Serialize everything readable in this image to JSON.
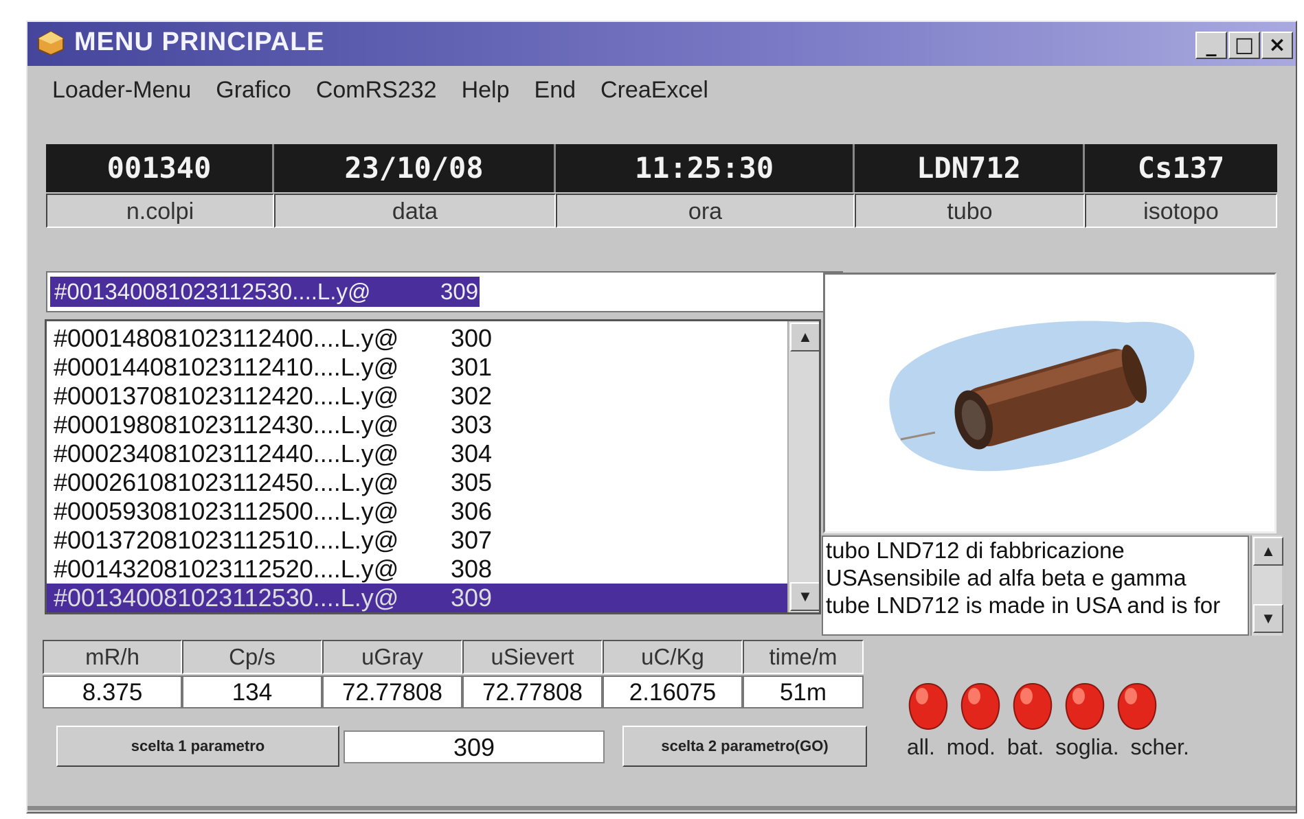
{
  "window": {
    "title": "MENU PRINCIPALE",
    "minimize": "_",
    "maximize": "□",
    "close": "×"
  },
  "menu": [
    "Loader-Menu",
    "Grafico",
    "ComRS232",
    "Help",
    "End",
    "CreaExcel"
  ],
  "info": [
    {
      "value": "001340",
      "label": "n.colpi"
    },
    {
      "value": "23/10/08",
      "label": "data"
    },
    {
      "value": "11:25:30",
      "label": "ora"
    },
    {
      "value": "LDN712",
      "label": "tubo"
    },
    {
      "value": "Cs137",
      "label": "isotopo"
    }
  ],
  "selected_record": {
    "code": "#001340081023112530....L.y@",
    "num": "309"
  },
  "records": [
    {
      "code": "#000148081023112400....L.y@",
      "num": "300"
    },
    {
      "code": "#000144081023112410....L.y@",
      "num": "301"
    },
    {
      "code": "#000137081023112420....L.y@",
      "num": "302"
    },
    {
      "code": "#000198081023112430....L.y@",
      "num": "303"
    },
    {
      "code": "#000234081023112440....L.y@",
      "num": "304"
    },
    {
      "code": "#000261081023112450....L.y@",
      "num": "305"
    },
    {
      "code": "#000593081023112500....L.y@",
      "num": "306"
    },
    {
      "code": "#001372081023112510....L.y@",
      "num": "307"
    },
    {
      "code": "#001432081023112520....L.y@",
      "num": "308"
    },
    {
      "code": "#001340081023112530....L.y@",
      "num": "309"
    }
  ],
  "description": [
    "tubo  LND712 di  fabbricazione",
    "USAsensibile ad alfa beta e gamma",
    "tube LND712 is made in USA and is for"
  ],
  "measures": [
    {
      "label": "mR/h",
      "value": "8.375"
    },
    {
      "label": "Cp/s",
      "value": "134"
    },
    {
      "label": "uGray",
      "value": "72.77808"
    },
    {
      "label": "uSievert",
      "value": "72.77808"
    },
    {
      "label": "uC/Kg",
      "value": "2.16075"
    },
    {
      "label": "time/m",
      "value": "51m"
    }
  ],
  "param": {
    "btn1": "scelta 1 parametro",
    "value": "309",
    "btn2": "scelta 2 parametro(GO)"
  },
  "leds": [
    "all.",
    "mod.",
    "bat.",
    "soglia.",
    "scher."
  ],
  "colors": {
    "title_start": "#45459c",
    "selection": "#4a2f9c",
    "led": "#e8201a",
    "panel": "#c6c6c6"
  }
}
